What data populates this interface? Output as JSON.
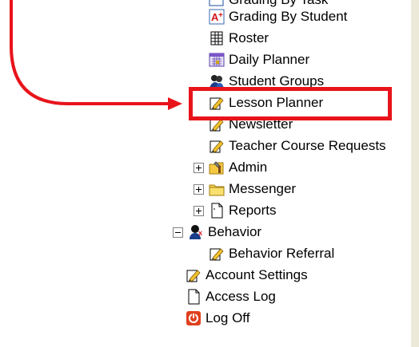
{
  "menu": {
    "grading_by_task": "Grading By Task",
    "grading_by_student": "Grading By Student",
    "roster": "Roster",
    "daily_planner": "Daily Planner",
    "student_groups": "Student Groups",
    "lesson_planner": "Lesson Planner",
    "newsletter": "Newsletter",
    "teacher_course_requests": "Teacher Course Requests",
    "admin": "Admin",
    "messenger": "Messenger",
    "reports": "Reports",
    "behavior": "Behavior",
    "behavior_referral": "Behavior Referral",
    "account_settings": "Account Settings",
    "access_log": "Access Log",
    "log_off": "Log Off"
  },
  "colors": {
    "highlight": "#e8141b",
    "arrow": "#e8141b"
  }
}
